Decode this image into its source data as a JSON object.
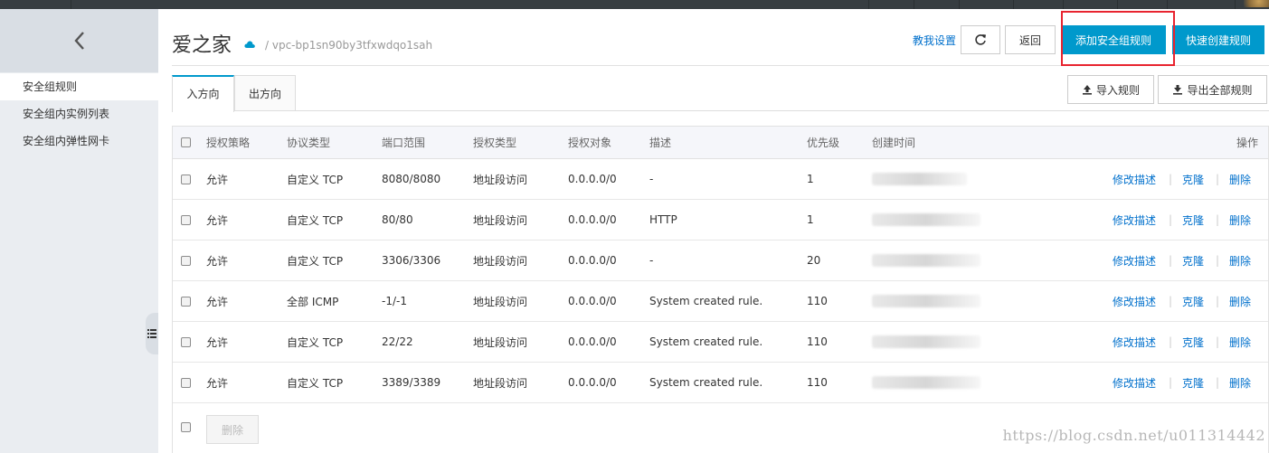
{
  "sidebar": {
    "back_icon": "chevron-left-icon",
    "items": [
      {
        "label": "安全组规则",
        "active": true
      },
      {
        "label": "安全组内实例列表",
        "active": false
      },
      {
        "label": "安全组内弹性网卡",
        "active": false
      }
    ]
  },
  "header": {
    "title": "爱之家",
    "vpc": "/ vpc-bp1sn90by3tfxwdqo1sah",
    "tutorial_link": "教我设置",
    "refresh_icon": "refresh-icon",
    "back_button": "返回",
    "add_rule_button": "添加安全组规则",
    "quick_create_button": "快速创建规则"
  },
  "tabs": [
    {
      "label": "入方向",
      "active": true
    },
    {
      "label": "出方向",
      "active": false
    }
  ],
  "toolbar": {
    "import_button": "导入规则",
    "export_button": "导出全部规则"
  },
  "table": {
    "columns": [
      "授权策略",
      "协议类型",
      "端口范围",
      "授权类型",
      "授权对象",
      "描述",
      "优先级",
      "创建时间",
      "操作"
    ],
    "rows": [
      {
        "policy": "允许",
        "protocol": "自定义 TCP",
        "port": "8080/8080",
        "auth_type": "地址段访问",
        "auth_object": "0.0.0.0/0",
        "desc": "-",
        "priority": "1"
      },
      {
        "policy": "允许",
        "protocol": "自定义 TCP",
        "port": "80/80",
        "auth_type": "地址段访问",
        "auth_object": "0.0.0.0/0",
        "desc": "HTTP",
        "priority": "1"
      },
      {
        "policy": "允许",
        "protocol": "自定义 TCP",
        "port": "3306/3306",
        "auth_type": "地址段访问",
        "auth_object": "0.0.0.0/0",
        "desc": "-",
        "priority": "20"
      },
      {
        "policy": "允许",
        "protocol": "全部 ICMP",
        "port": "-1/-1",
        "auth_type": "地址段访问",
        "auth_object": "0.0.0.0/0",
        "desc": "System created rule.",
        "priority": "110"
      },
      {
        "policy": "允许",
        "protocol": "自定义 TCP",
        "port": "22/22",
        "auth_type": "地址段访问",
        "auth_object": "0.0.0.0/0",
        "desc": "System created rule.",
        "priority": "110"
      },
      {
        "policy": "允许",
        "protocol": "自定义 TCP",
        "port": "3389/3389",
        "auth_type": "地址段访问",
        "auth_object": "0.0.0.0/0",
        "desc": "System created rule.",
        "priority": "110"
      }
    ],
    "actions": {
      "edit": "修改描述",
      "clone": "克隆",
      "delete": "删除"
    },
    "bulk_delete": "删除"
  },
  "watermark": "https://blog.csdn.net/u011314442",
  "colors": {
    "primary": "#0099cc",
    "link": "#0070cc",
    "highlight": "#e8242f"
  }
}
